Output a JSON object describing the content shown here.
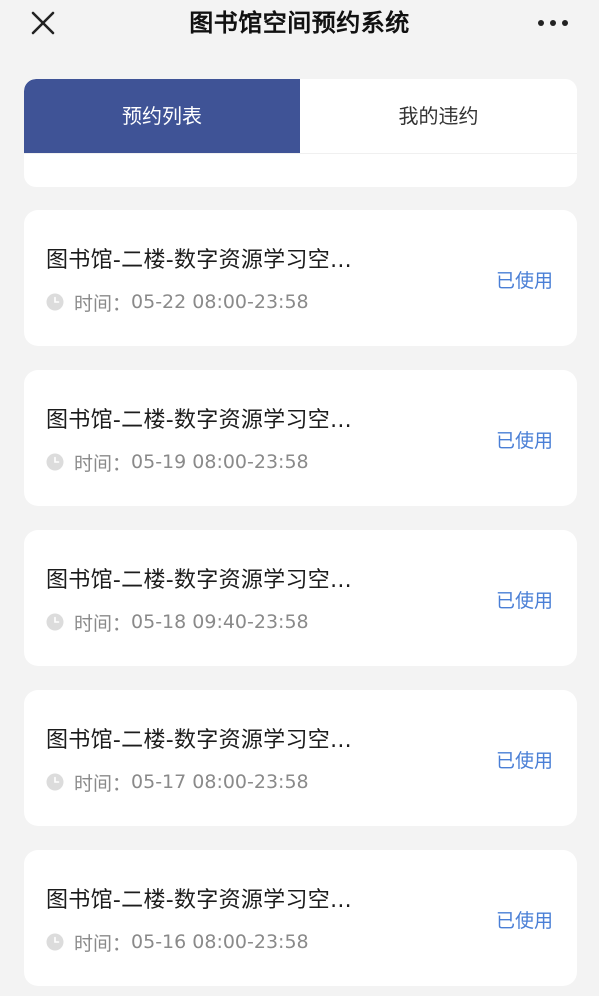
{
  "header": {
    "title": "图书馆空间预约系统",
    "close_icon": "close-icon",
    "more_icon": "more-icon"
  },
  "tabs": [
    {
      "label": "预约列表",
      "active": true
    },
    {
      "label": "我的违约",
      "active": false
    }
  ],
  "colors": {
    "accent": "#3f5396",
    "status": "#4a7fd6",
    "background": "#f3f3f3"
  },
  "reservations": [
    {
      "title": "图书馆-二楼-数字资源学习空...",
      "time_label": "时间：",
      "time": "05-22 08:00-23:58",
      "status": "已使用"
    },
    {
      "title": "图书馆-二楼-数字资源学习空...",
      "time_label": "时间：",
      "time": "05-19 08:00-23:58",
      "status": "已使用"
    },
    {
      "title": "图书馆-二楼-数字资源学习空...",
      "time_label": "时间：",
      "time": "05-18 09:40-23:58",
      "status": "已使用"
    },
    {
      "title": "图书馆-二楼-数字资源学习空...",
      "time_label": "时间：",
      "time": "05-17 08:00-23:58",
      "status": "已使用"
    },
    {
      "title": "图书馆-二楼-数字资源学习空...",
      "time_label": "时间：",
      "time": "05-16 08:00-23:58",
      "status": "已使用"
    }
  ]
}
